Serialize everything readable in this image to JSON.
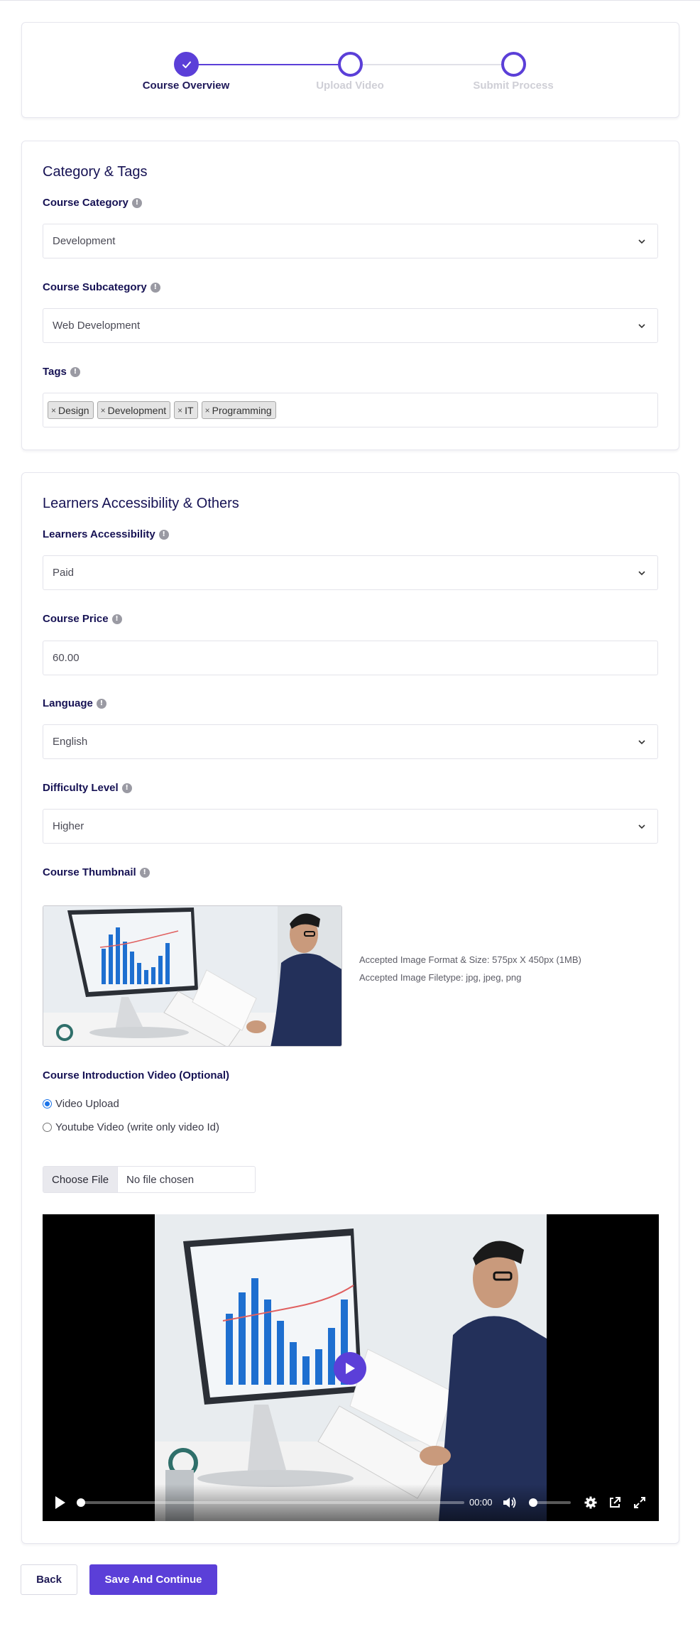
{
  "stepper": {
    "steps": [
      {
        "label": "Course Overview",
        "state": "done"
      },
      {
        "label": "Upload Video",
        "state": "pending"
      },
      {
        "label": "Submit Process",
        "state": "pending"
      }
    ],
    "accent": "#5b3fd8"
  },
  "category": {
    "title": "Category & Tags",
    "course_category_label": "Course Category",
    "course_category_value": "Development",
    "subcategory_label": "Course Subcategory",
    "subcategory_value": "Web Development",
    "tags_label": "Tags",
    "tags": [
      "Design",
      "Development",
      "IT",
      "Programming"
    ],
    "tag_remove_glyph": "×"
  },
  "learners": {
    "title": "Learners Accessibility & Others",
    "accessibility_label": "Learners Accessibility",
    "accessibility_value": "Paid",
    "price_label": "Course Price",
    "price_value": "60.00",
    "language_label": "Language",
    "language_value": "English",
    "difficulty_label": "Difficulty Level",
    "difficulty_value": "Higher",
    "thumbnail_label": "Course Thumbnail",
    "thumbnail_note_size": "Accepted Image Format & Size: 575px X 450px (1MB)",
    "thumbnail_note_type": "Accepted Image Filetype: jpg, jpeg, png",
    "intro_video_label": "Course Introduction Video (Optional)",
    "radio_video_upload": "Video Upload",
    "radio_youtube": "Youtube Video (write only video Id)",
    "file_button": "Choose File",
    "file_status": "No file chosen",
    "video_time": "00:00",
    "video_progress": 0,
    "video_volume": 0
  },
  "info_glyph": "!",
  "actions": {
    "back": "Back",
    "save": "Save And Continue"
  }
}
